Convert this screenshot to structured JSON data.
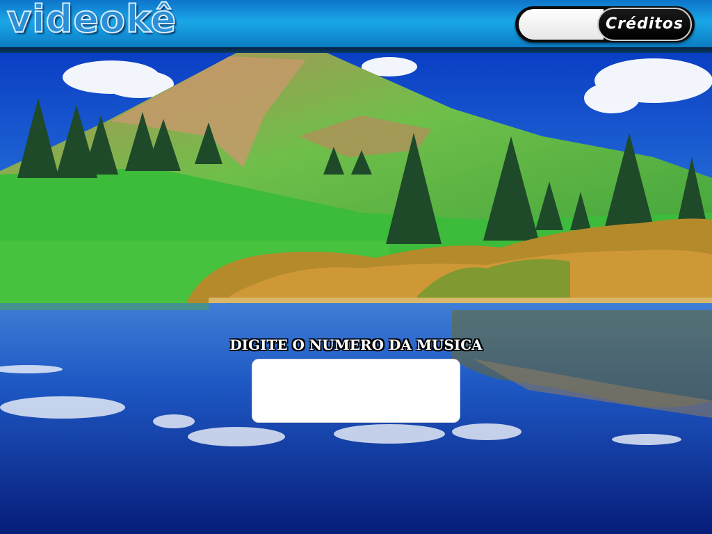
{
  "header": {
    "logo_text": "videokê",
    "credits_value": "",
    "credits_button_label": "Créditos"
  },
  "song_entry": {
    "prompt": "DIGITE O NUMERO DA MUSICA",
    "value": ""
  },
  "colors": {
    "header_blue": "#1aa7e8",
    "sky_blue": "#0a4fcf",
    "water_blue": "#0a2a8a",
    "grass_green": "#3dbb3a"
  }
}
